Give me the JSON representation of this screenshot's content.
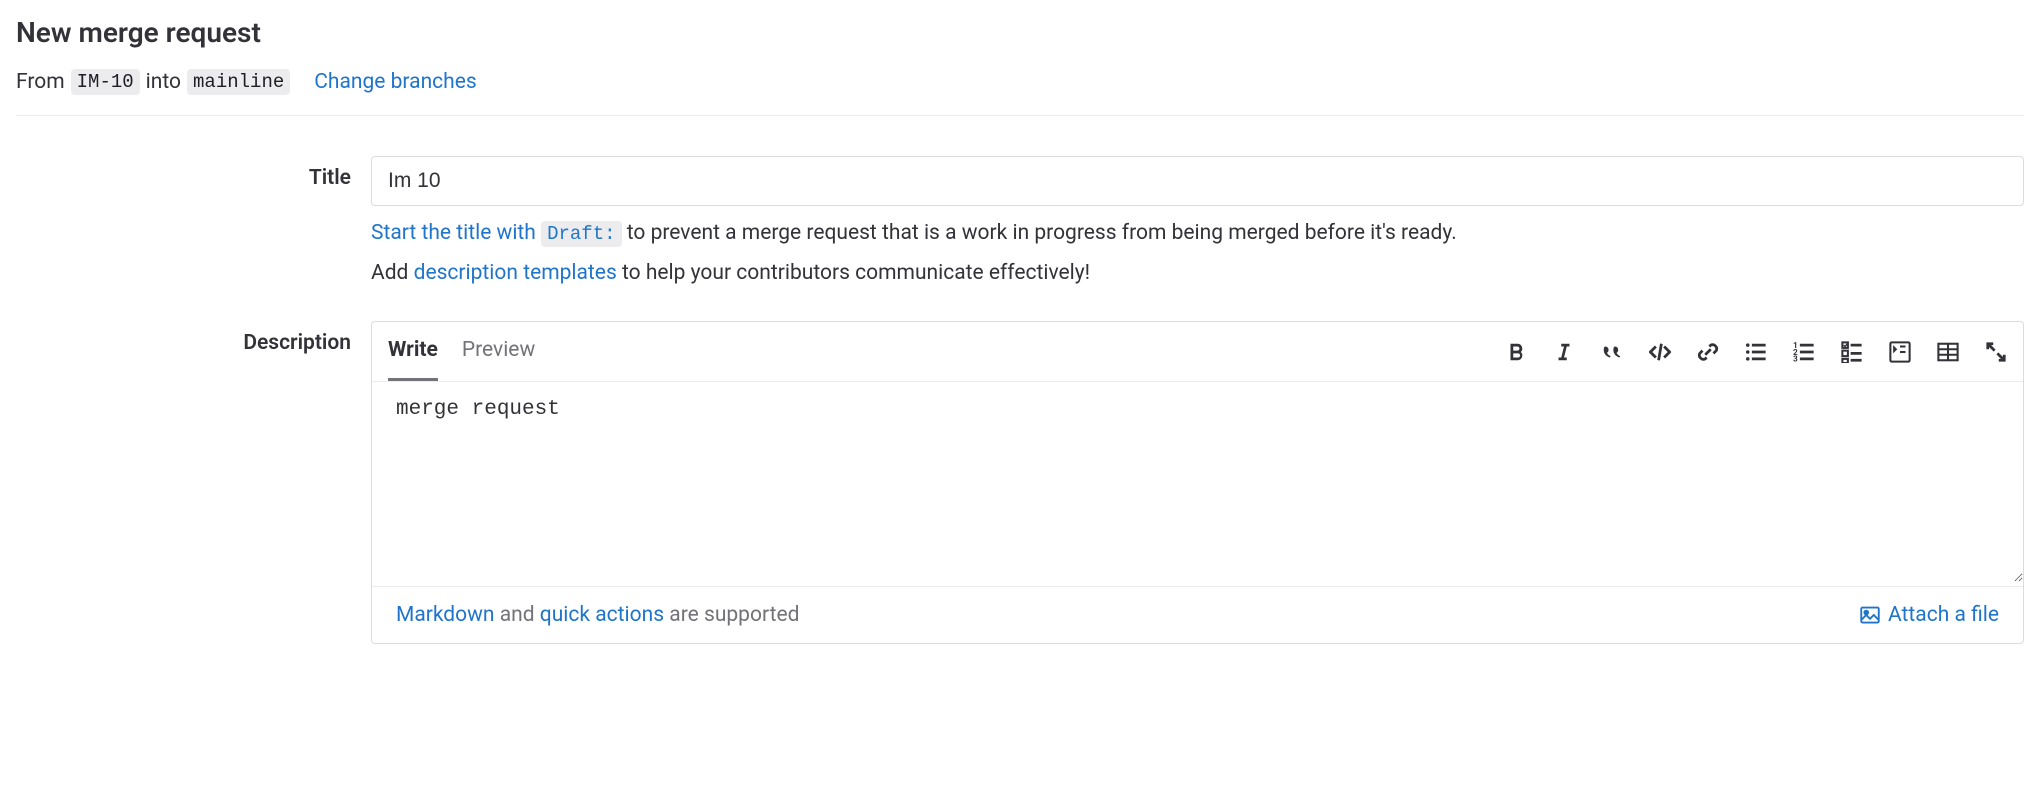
{
  "page": {
    "title": "New merge request"
  },
  "branches": {
    "from_label": "From",
    "source": "IM-10",
    "into_label": "into",
    "target": "mainline",
    "change_link": "Change branches"
  },
  "form": {
    "title": {
      "label": "Title",
      "value": "Im 10",
      "hint_prefix": "Start the title with ",
      "hint_code": "Draft:",
      "hint_suffix": " to prevent a merge request that is a work in progress from being merged before it's ready.",
      "hint2_prefix": "Add ",
      "hint2_link": "description templates",
      "hint2_suffix": " to help your contributors communicate effectively!"
    },
    "description": {
      "label": "Description",
      "tabs": {
        "write": "Write",
        "preview": "Preview"
      },
      "value": "merge request",
      "footer_markdown": "Markdown",
      "footer_and": " and ",
      "footer_quick_actions": "quick actions",
      "footer_suffix": " are supported",
      "attach_label": "Attach a file"
    }
  }
}
